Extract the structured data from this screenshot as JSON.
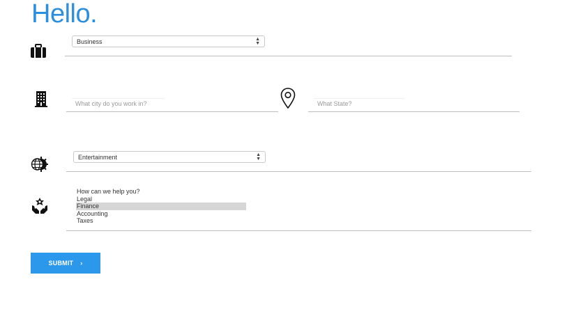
{
  "header": {
    "title": "Hello."
  },
  "business": {
    "selected": "Business"
  },
  "location": {
    "city_placeholder": "What city do you work in?",
    "state_placeholder": "What State?"
  },
  "industry": {
    "selected": "Entertainment"
  },
  "help": {
    "options": [
      "How can we help you?",
      "Legal",
      "Finance",
      "Accounting",
      "Taxes"
    ],
    "selected": "Finance"
  },
  "form": {
    "submit_label": "SUBMIT",
    "submit_chevron": "›"
  },
  "colors": {
    "accent": "#2b8fe0",
    "button": "#2b98ec"
  },
  "icons": [
    "briefcase-icon",
    "building-icon",
    "map-pin-icon",
    "globe-gear-icon",
    "helping-hands-icon"
  ]
}
